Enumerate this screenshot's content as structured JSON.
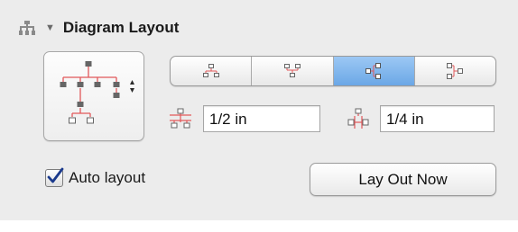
{
  "header": {
    "title": "Diagram Layout",
    "section_icon": "hierarchy-icon",
    "disclosure_icon": "disclosure-triangle-down-icon"
  },
  "layout_style_popup": {
    "icon": "tree-layout-icon",
    "arrows_icon": "up-down-arrows-icon"
  },
  "direction_segments": [
    {
      "icon": "layout-top-to-bottom-icon",
      "selected": false
    },
    {
      "icon": "layout-bottom-to-top-icon",
      "selected": false
    },
    {
      "icon": "layout-left-to-right-icon",
      "selected": true
    },
    {
      "icon": "layout-right-to-left-icon",
      "selected": false
    }
  ],
  "spacing": {
    "rank_icon": "rank-spacing-icon",
    "rank_value": "1/2 in",
    "object_icon": "object-spacing-icon",
    "object_value": "1/4 in"
  },
  "auto_layout": {
    "label": "Auto layout",
    "checked": true
  },
  "lay_out_button": {
    "label": "Lay Out Now"
  },
  "colors": {
    "accent_red": "#e2585a",
    "selected_segment": "#7fb4ec",
    "panel_background": "#ececec"
  }
}
